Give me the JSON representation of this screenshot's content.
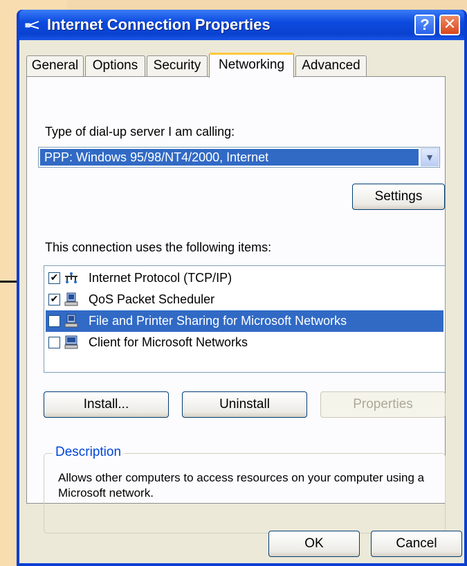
{
  "window": {
    "title": "Internet Connection Properties",
    "help_label": "?",
    "close_label": "✕"
  },
  "tabs": [
    {
      "label": "General"
    },
    {
      "label": "Options"
    },
    {
      "label": "Security"
    },
    {
      "label": "Networking",
      "active": true
    },
    {
      "label": "Advanced"
    }
  ],
  "networking": {
    "server_type_label": "Type of dial-up server I am calling:",
    "server_type_value": "PPP: Windows 95/98/NT4/2000, Internet",
    "settings_button": "Settings",
    "items_label": "This connection uses the following items:",
    "items": [
      {
        "label": "Internet Protocol (TCP/IP)",
        "checked": true,
        "icon": "network-protocol-icon"
      },
      {
        "label": "QoS Packet Scheduler",
        "checked": true,
        "icon": "network-service-icon"
      },
      {
        "label": "File and Printer Sharing for Microsoft Networks",
        "checked": false,
        "selected": true,
        "icon": "network-service-icon"
      },
      {
        "label": "Client for Microsoft Networks",
        "checked": false,
        "icon": "network-client-icon"
      }
    ],
    "install_button": "Install...",
    "uninstall_button": "Uninstall",
    "properties_button": "Properties",
    "description_title": "Description",
    "description_text": "Allows other computers to access resources on your computer using a Microsoft network."
  },
  "footer": {
    "ok_button": "OK",
    "cancel_button": "Cancel"
  },
  "colors": {
    "selection": "#316ac5",
    "titlebar": "#0a42d0",
    "background": "#f8ddb1"
  }
}
